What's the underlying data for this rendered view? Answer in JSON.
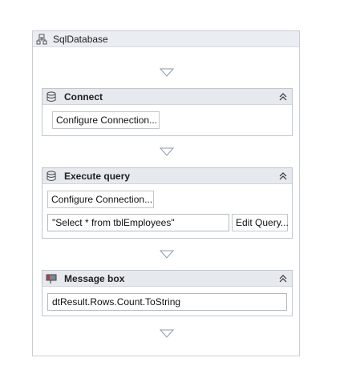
{
  "sequence": {
    "title": "SqlDatabase"
  },
  "connect": {
    "title": "Connect",
    "configure_label": "Configure Connection..."
  },
  "execute_query": {
    "title": "Execute query",
    "configure_label": "Configure Connection...",
    "query_value": "\"Select * from tblEmployees\"",
    "edit_query_label": "Edit Query..."
  },
  "message_box": {
    "title": "Message box",
    "text_value": "dtResult.Rows.Count.ToString"
  },
  "icons": {
    "sequence": "sequence-icon",
    "database": "database-icon",
    "message": "message-box-icon",
    "collapse": "double-chevron-up-icon",
    "drop": "drop-arrow-icon"
  },
  "colors": {
    "header_bg": "#e6e9ee",
    "border": "#bfc6d0",
    "arrow": "#8e9aa8"
  }
}
